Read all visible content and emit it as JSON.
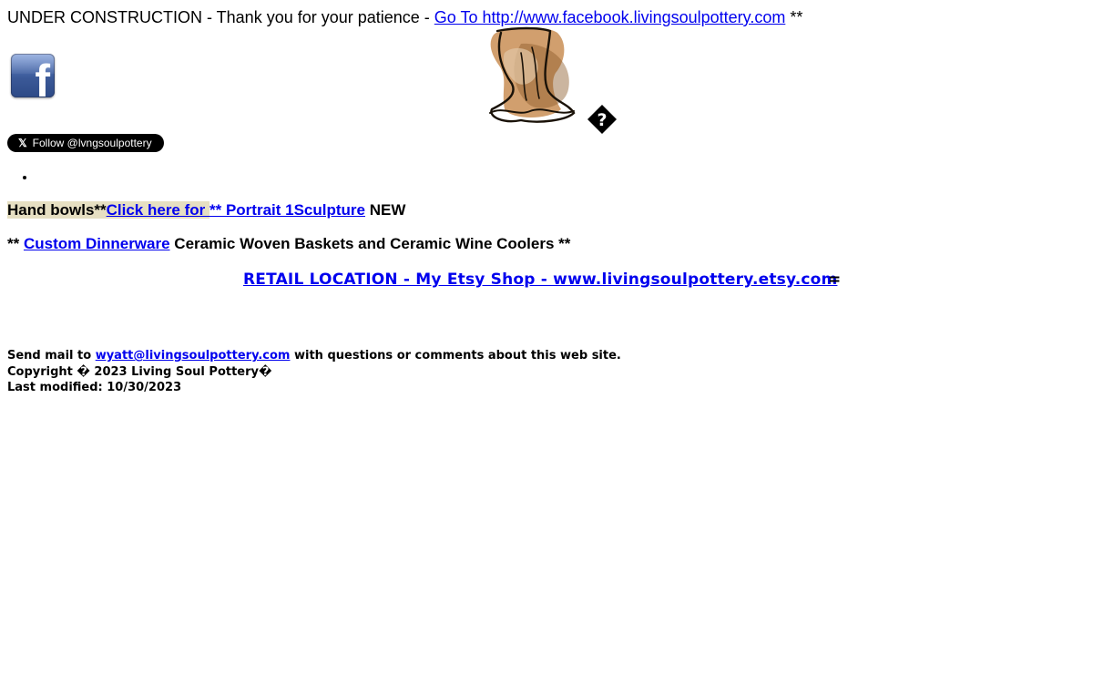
{
  "header": {
    "notice_text": "UNDER CONSTRUCTION - Thank you for your patience - ",
    "facebook_link_text": "Go To http://www.facebook.livingsoulpottery.com",
    "notice_suffix": " **"
  },
  "icons": {
    "facebook": "facebook-icon",
    "logo": "pottery-vase-logo",
    "missing": "missing-glyph-icon",
    "bullet": "bullet-icon"
  },
  "twitter": {
    "x_mark": "𝕏",
    "label": "Follow @lvngsoulpottery"
  },
  "colors": {
    "link": "#0000ee",
    "highlight": "#e6dfc2",
    "facebook_blue": "#3b5998"
  },
  "line1": {
    "hand_bowls": "Hand bowls**",
    "click_here": "Click here for ",
    "portrait_link": "** Portrait 1Sculpture",
    "new": " NEW"
  },
  "line2": {
    "prefix": " ** ",
    "custom_link": "Custom Dinnerware",
    "rest": " Ceramic Woven Baskets and Ceramic Wine Coolers **"
  },
  "retail": {
    "link": "RETAIL LOCATION - My Etsy Shop - www.livingsoulpottery.etsy.com",
    "equals": "="
  },
  "footer": {
    "mail_prefix": "Send mail to ",
    "email": "wyatt@livingsoulpottery.com",
    "mail_suffix": " with questions or comments about this web site.",
    "copyright": "Copyright � 2023 Living Soul Pottery�",
    "modified": "Last modified: 10/30/2023"
  }
}
